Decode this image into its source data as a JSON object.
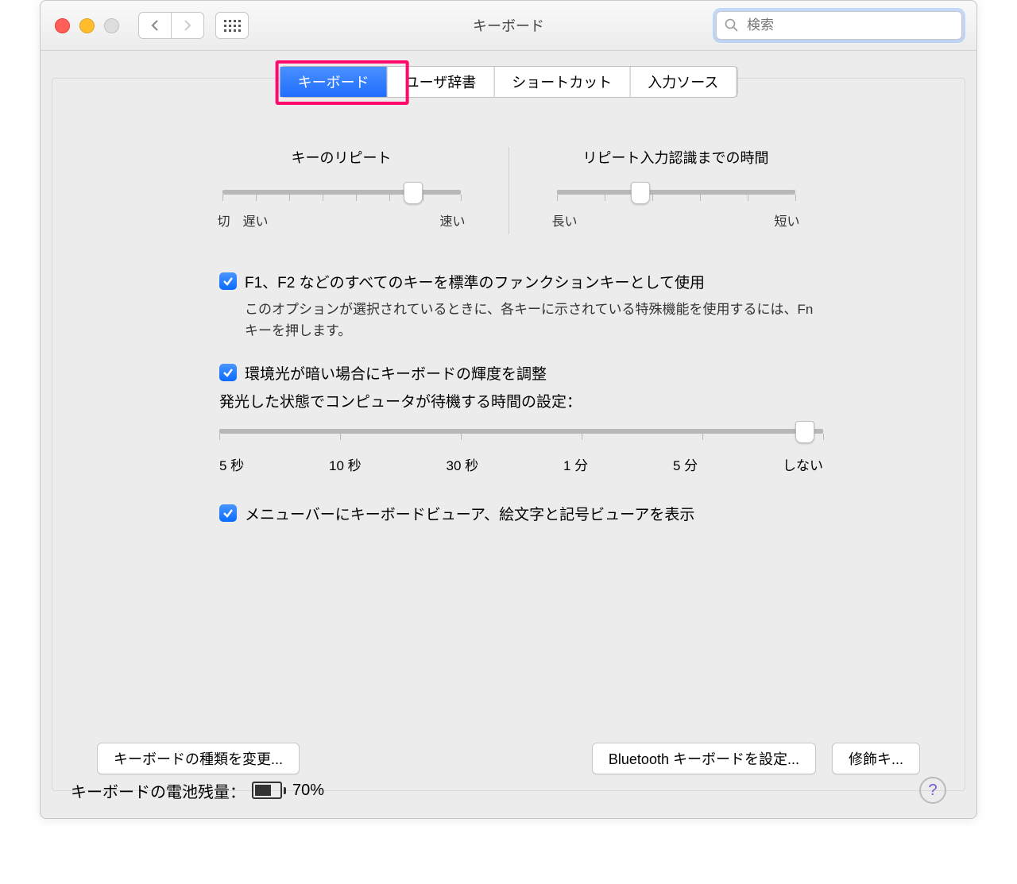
{
  "window": {
    "title": "キーボード",
    "search_placeholder": "検索"
  },
  "tabs": [
    {
      "label": "キーボード",
      "active": true
    },
    {
      "label": "ユーザ辞書",
      "active": false
    },
    {
      "label": "ショートカット",
      "active": false
    },
    {
      "label": "入力ソース",
      "active": false
    }
  ],
  "sliders": {
    "repeat": {
      "title": "キーのリピート",
      "left": "切",
      "mid": "遅い",
      "right": "速い",
      "value_pct": 80,
      "ticks": 8
    },
    "delay": {
      "title": "リピート入力認識までの時間",
      "left": "長い",
      "right": "短い",
      "value_pct": 35,
      "ticks": 6
    }
  },
  "check_fn": {
    "label": "F1、F2 などのすべてのキーを標準のファンクションキーとして使用",
    "desc": "このオプションが選択されているときに、各キーに示されている特殊機能を使用するには、Fn キーを押します。"
  },
  "check_light": {
    "label": "環境光が暗い場合にキーボードの輝度を調整"
  },
  "wait_label": "発光した状態でコンピュータが待機する時間の設定：",
  "wait_slider": {
    "labels": [
      "5 秒",
      "10 秒",
      "30 秒",
      "1 分",
      "5 分",
      "しない"
    ],
    "value_pct": 97
  },
  "check_viewer": {
    "label": "メニューバーにキーボードビューア、絵文字と記号ビューアを表示"
  },
  "buttons": {
    "change_type": "キーボードの種類を変更...",
    "bluetooth": "Bluetooth キーボードを設定...",
    "modifier": "修飾キ..."
  },
  "footer": {
    "battery_label": "キーボードの電池残量：",
    "battery_pct": "70%"
  }
}
